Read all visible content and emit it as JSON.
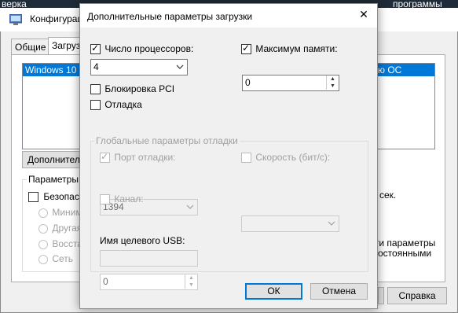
{
  "desktop": {
    "top_left_text": "верка",
    "top_right_text": "программы"
  },
  "background_window": {
    "title": "Конфигураци",
    "tabs": [
      {
        "label": "Общие"
      },
      {
        "label": "Загрузк"
      }
    ],
    "os_list": [
      {
        "left": "Windows 10 (C",
        "right": "ю ОС"
      }
    ],
    "advanced_button": "Дополнитель",
    "boot_options_label": "Параметры з",
    "safe_mode": "Безопасн",
    "radios": [
      "Минима",
      "Другая",
      "Восстан",
      "Сеть"
    ],
    "timeout_text": "сек.",
    "persistent_text_1": "ги параметры",
    "persistent_text_2": "остоянными",
    "help_button": "Справка"
  },
  "dialog": {
    "title": "Дополнительные параметры загрузки",
    "close_glyph": "✕",
    "num_processors": {
      "label": "Число процессоров:",
      "checked": true,
      "value": "4"
    },
    "max_memory": {
      "label": "Максимум памяти:",
      "checked": true,
      "value": "0"
    },
    "pci_lock": {
      "label": "Блокировка PCI",
      "checked": false
    },
    "debug": {
      "label": "Отладка",
      "checked": false
    },
    "debug_group": {
      "title": "Глобальные параметры отладки",
      "debug_port": {
        "label": "Порт отладки:",
        "checked": true,
        "value": "1394"
      },
      "baud_rate": {
        "label": "Скорость (бит/с):",
        "checked": false,
        "value": ""
      },
      "channel": {
        "label": "Канал:",
        "checked": false,
        "value": "0"
      },
      "usb_target": {
        "label": "Имя целевого USB:",
        "value": ""
      }
    },
    "ok_button": "ОК",
    "cancel_button": "Отмена"
  },
  "colors": {
    "desktop": "#1e2b38",
    "selection": "#0078d7",
    "window_bg": "#f0f0f0",
    "disabled_text": "#a0a0a0"
  }
}
